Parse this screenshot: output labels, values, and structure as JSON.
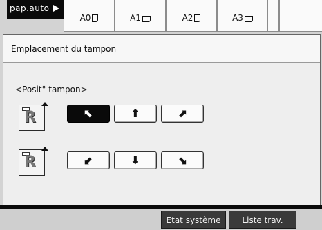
{
  "top_bar": {
    "paper_auto_label": "pap.auto",
    "sizes": [
      {
        "label": "A0",
        "orientation": "portrait"
      },
      {
        "label": "A1",
        "orientation": "landscape"
      },
      {
        "label": "A2",
        "orientation": "portrait"
      },
      {
        "label": "A3",
        "orientation": "landscape"
      }
    ]
  },
  "panel": {
    "title": "Emplacement du tampon",
    "section_label": "<Posit° tampon>",
    "rows": [
      {
        "icon": "r-document-top-stamp-icon",
        "buttons": [
          {
            "name": "top-left",
            "glyph": "⬉",
            "selected": true
          },
          {
            "name": "top-center",
            "glyph": "⬆",
            "selected": false
          },
          {
            "name": "top-right",
            "glyph": "⬈",
            "selected": false
          }
        ]
      },
      {
        "icon": "r-document-bottom-stamp-icon",
        "buttons": [
          {
            "name": "bottom-left",
            "glyph": "⬋",
            "selected": false
          },
          {
            "name": "bottom-center",
            "glyph": "⬇",
            "selected": false
          },
          {
            "name": "bottom-right",
            "glyph": "⬊",
            "selected": false
          }
        ]
      }
    ]
  },
  "footer": {
    "system_status_label": "Etat système",
    "job_list_label": "Liste trav."
  },
  "colors": {
    "selected": "#0a0a0a",
    "button_bg": "#fbfbfb",
    "panel_bg": "#eeeeee"
  }
}
